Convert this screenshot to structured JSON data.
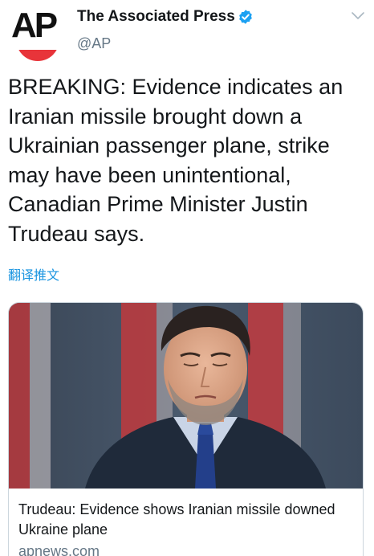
{
  "account": {
    "name": "The Associated Press",
    "handle": "@AP",
    "avatar_text": "AP",
    "verified": true
  },
  "tweet": {
    "text": "BREAKING: Evidence indicates an Iranian missile brought down a Ukrainian passenger plane, strike may have been unintentional, Canadian Prime Minister Justin Trudeau says.",
    "translate_label": "翻译推文"
  },
  "card": {
    "title": "Trudeau: Evidence shows Iranian missile downed Ukraine plane",
    "domain": "apnews.com"
  },
  "colors": {
    "verified_blue": "#1da1f2",
    "link_blue": "#1b95e0",
    "ap_red": "#e8343a",
    "secondary_text": "#657786"
  },
  "icons": {
    "verified": "verified-badge-icon",
    "menu": "chevron-down-icon"
  }
}
